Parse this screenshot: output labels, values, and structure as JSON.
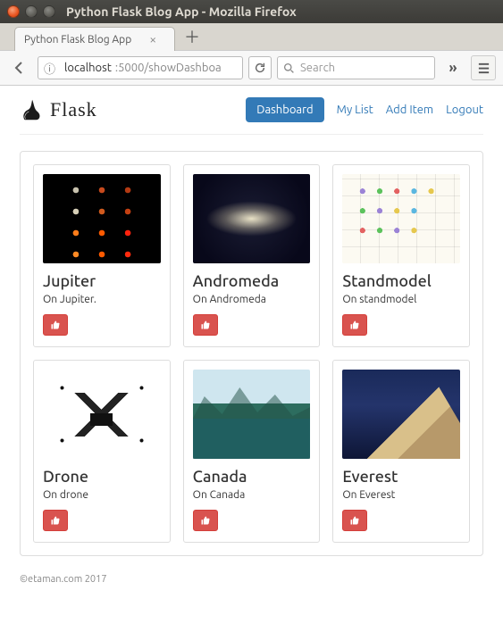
{
  "window": {
    "title": "Python Flask Blog App - Mozilla Firefox"
  },
  "tab": {
    "title": "Python Flask Blog App"
  },
  "urlbar": {
    "scheme_icon": "ⓘ",
    "host": "localhost",
    "rest": ":5000/showDashboa"
  },
  "search": {
    "placeholder": "Search"
  },
  "header": {
    "logo_text": "Flask",
    "nav": {
      "dashboard": "Dashboard",
      "mylist": "My List",
      "additem": "Add Item",
      "logout": "Logout"
    }
  },
  "cards": [
    {
      "title": "Jupiter",
      "sub": "On Jupiter.",
      "thumb": "thumb-jupiter"
    },
    {
      "title": "Andromeda",
      "sub": "On Andromeda",
      "thumb": "thumb-andromeda"
    },
    {
      "title": "Standmodel",
      "sub": "On standmodel",
      "thumb": "thumb-standard"
    },
    {
      "title": "Drone",
      "sub": "On drone",
      "thumb": "thumb-drone"
    },
    {
      "title": "Canada",
      "sub": "On Canada",
      "thumb": "thumb-canada"
    },
    {
      "title": "Everest",
      "sub": "On Everest",
      "thumb": "thumb-everest"
    }
  ],
  "footer": {
    "text": "©etaman.com 2017"
  }
}
